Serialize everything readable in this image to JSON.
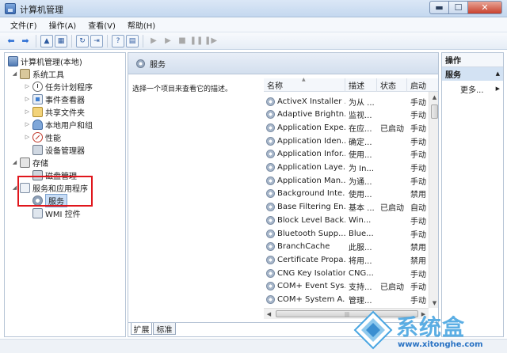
{
  "window": {
    "title": "计算机管理"
  },
  "menu": [
    "文件(F)",
    "操作(A)",
    "查看(V)",
    "帮助(H)"
  ],
  "tree": {
    "root": "计算机管理(本地)",
    "system_tools": "系统工具",
    "task_scheduler": "任务计划程序",
    "event_viewer": "事件查看器",
    "shared_folders": "共享文件夹",
    "local_users": "本地用户和组",
    "performance": "性能",
    "device_manager": "设备管理器",
    "storage": "存储",
    "disk_management": "磁盘管理",
    "services_apps": "服务和应用程序",
    "services": "服务",
    "wmi": "WMI 控件"
  },
  "center": {
    "header": "服务",
    "description": "选择一个项目来查看它的描述。",
    "columns": {
      "name": "名称",
      "desc": "描述",
      "status": "状态",
      "startup": "启动"
    },
    "rows": [
      {
        "name": "ActiveX Installer ...",
        "desc": "为从 ...",
        "status": "",
        "startup": "手动"
      },
      {
        "name": "Adaptive Brightn...",
        "desc": "监视...",
        "status": "",
        "startup": "手动"
      },
      {
        "name": "Application Expe...",
        "desc": "在应...",
        "status": "已启动",
        "startup": "手动"
      },
      {
        "name": "Application Iden...",
        "desc": "确定...",
        "status": "",
        "startup": "手动"
      },
      {
        "name": "Application Infor...",
        "desc": "使用...",
        "status": "",
        "startup": "手动"
      },
      {
        "name": "Application Laye...",
        "desc": "为 In...",
        "status": "",
        "startup": "手动"
      },
      {
        "name": "Application Man...",
        "desc": "为通...",
        "status": "",
        "startup": "手动"
      },
      {
        "name": "Background Inte...",
        "desc": "使用...",
        "status": "",
        "startup": "禁用"
      },
      {
        "name": "Base Filtering En...",
        "desc": "基本 ...",
        "status": "已启动",
        "startup": "自动"
      },
      {
        "name": "Block Level Back...",
        "desc": "Win...",
        "status": "",
        "startup": "手动"
      },
      {
        "name": "Bluetooth Supp...",
        "desc": "Blue...",
        "status": "",
        "startup": "手动"
      },
      {
        "name": "BranchCache",
        "desc": "此服...",
        "status": "",
        "startup": "禁用"
      },
      {
        "name": "Certificate Propa...",
        "desc": "将用...",
        "status": "",
        "startup": "禁用"
      },
      {
        "name": "CNG Key Isolation",
        "desc": "CNG...",
        "status": "",
        "startup": "手动"
      },
      {
        "name": "COM+ Event Sys...",
        "desc": "支持...",
        "status": "已启动",
        "startup": "手动"
      },
      {
        "name": "COM+ System A...",
        "desc": "管理...",
        "status": "",
        "startup": "手动"
      }
    ]
  },
  "tabs": [
    "扩展",
    "标准"
  ],
  "actions": {
    "title": "操作",
    "section": "服务",
    "more": "更多..."
  },
  "watermark": {
    "text": "系统盒",
    "url": "www.xitonghe.com"
  },
  "colors": {
    "highlight": "#e0161c",
    "selection": "#c7dcf5",
    "watermark": "#4aa6e2"
  }
}
